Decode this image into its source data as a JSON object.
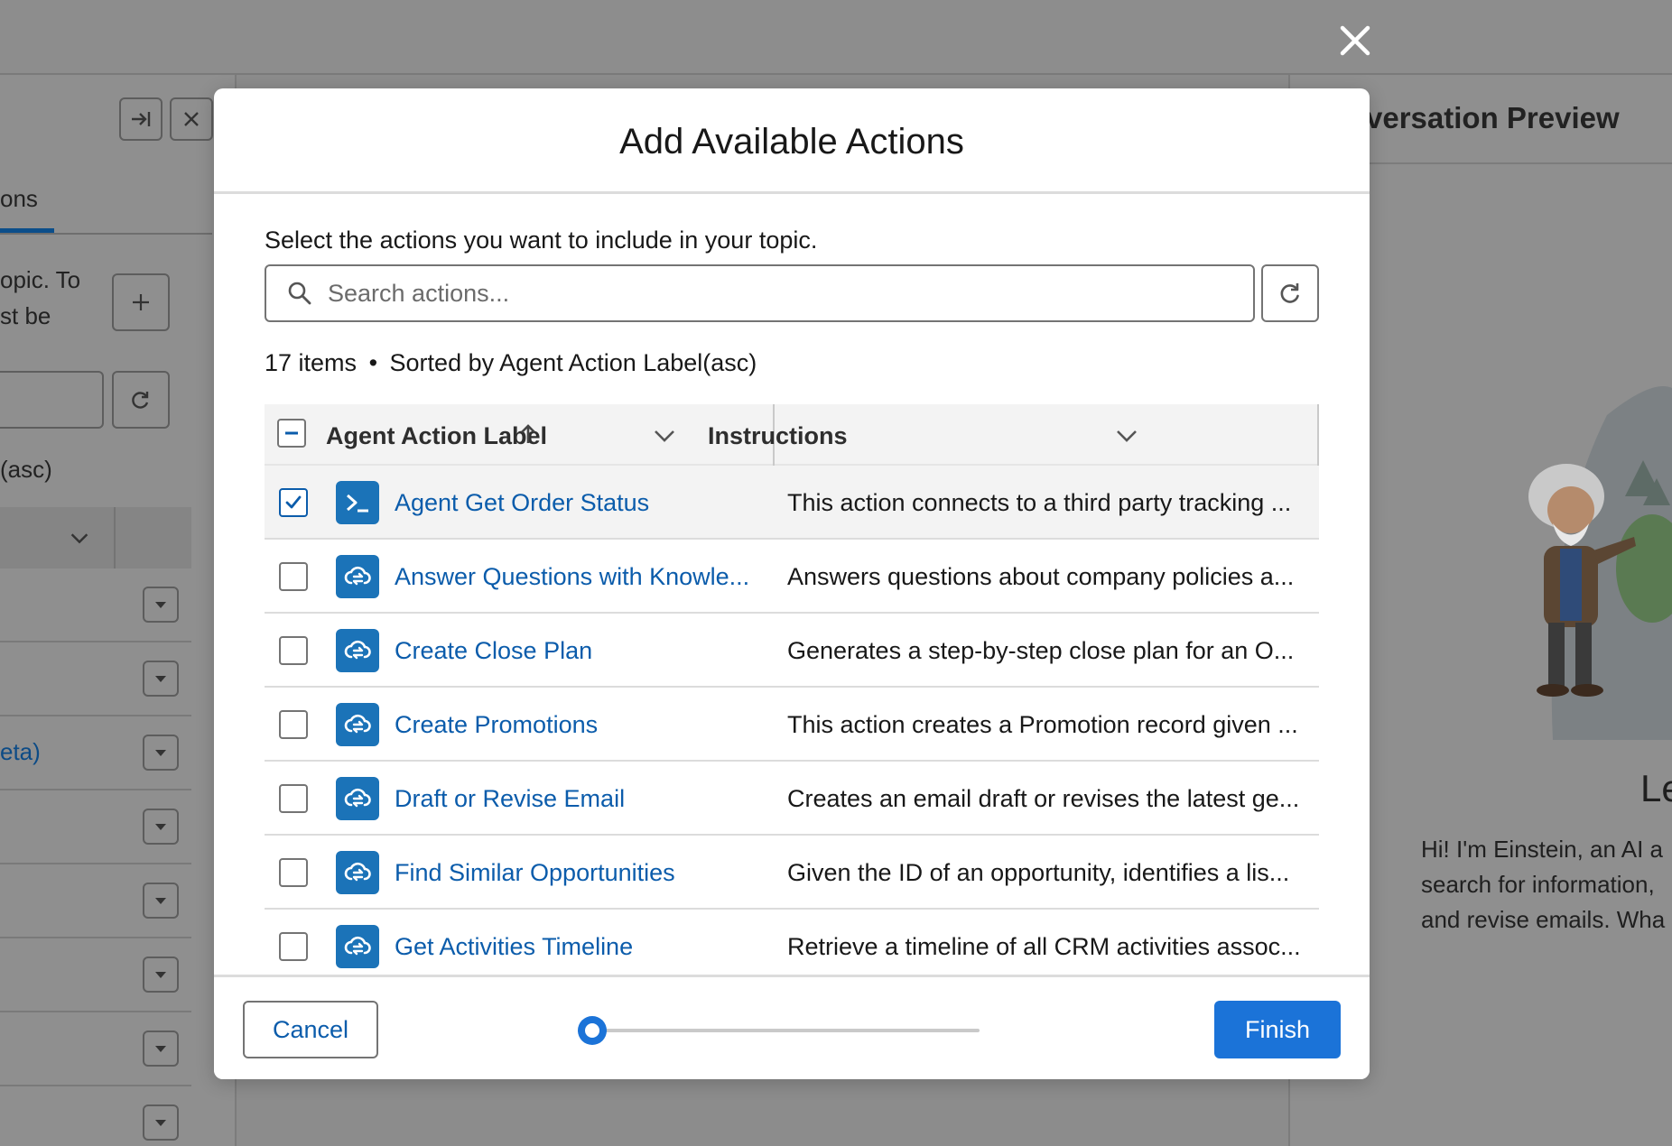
{
  "background": {
    "left_panel": {
      "tab_label": "ons",
      "description": "opic. To st be",
      "sort_text": "(asc)",
      "link_text": "eta)"
    },
    "preview": {
      "title": "versation Preview",
      "welcome": "Le",
      "greeting_lines": [
        "Hi! I'm Einstein, an AI a",
        "search for information,",
        "and revise emails. Wha"
      ]
    }
  },
  "modal": {
    "title": "Add Available Actions",
    "instruction": "Select the actions you want to include in your topic.",
    "search": {
      "placeholder": "Search actions...",
      "value": ""
    },
    "meta": {
      "count": "17 items",
      "separator": "•",
      "sort": "Sorted by Agent Action Label(asc)"
    },
    "columns": {
      "label": "Agent Action Label",
      "instructions": "Instructions"
    },
    "rows": [
      {
        "label": "Agent Get Order Status",
        "instructions": "This action connects to a third party tracking ...",
        "checked": true,
        "icon": "terminal-icon"
      },
      {
        "label": "Answer Questions with Knowle...",
        "instructions": "Answers questions about company policies a...",
        "checked": false,
        "icon": "cloud-flow-icon"
      },
      {
        "label": "Create Close Plan",
        "instructions": "Generates a step-by-step close plan for an O...",
        "checked": false,
        "icon": "cloud-flow-icon"
      },
      {
        "label": "Create Promotions",
        "instructions": "This action creates a Promotion record given ...",
        "checked": false,
        "icon": "cloud-flow-icon"
      },
      {
        "label": "Draft or Revise Email",
        "instructions": "Creates an email draft or revises the latest ge...",
        "checked": false,
        "icon": "cloud-flow-icon"
      },
      {
        "label": "Find Similar Opportunities",
        "instructions": "Given the ID of an opportunity, identifies a lis...",
        "checked": false,
        "icon": "cloud-flow-icon"
      },
      {
        "label": "Get Activities Timeline",
        "instructions": "Retrieve a timeline of all CRM activities assoc...",
        "checked": false,
        "icon": "cloud-flow-icon"
      }
    ],
    "footer": {
      "cancel_label": "Cancel",
      "finish_label": "Finish",
      "progress": 0
    }
  },
  "colors": {
    "brand": "#0b5cab",
    "button_brand": "#1b73d8",
    "icon_bg": "#1b73b8"
  }
}
